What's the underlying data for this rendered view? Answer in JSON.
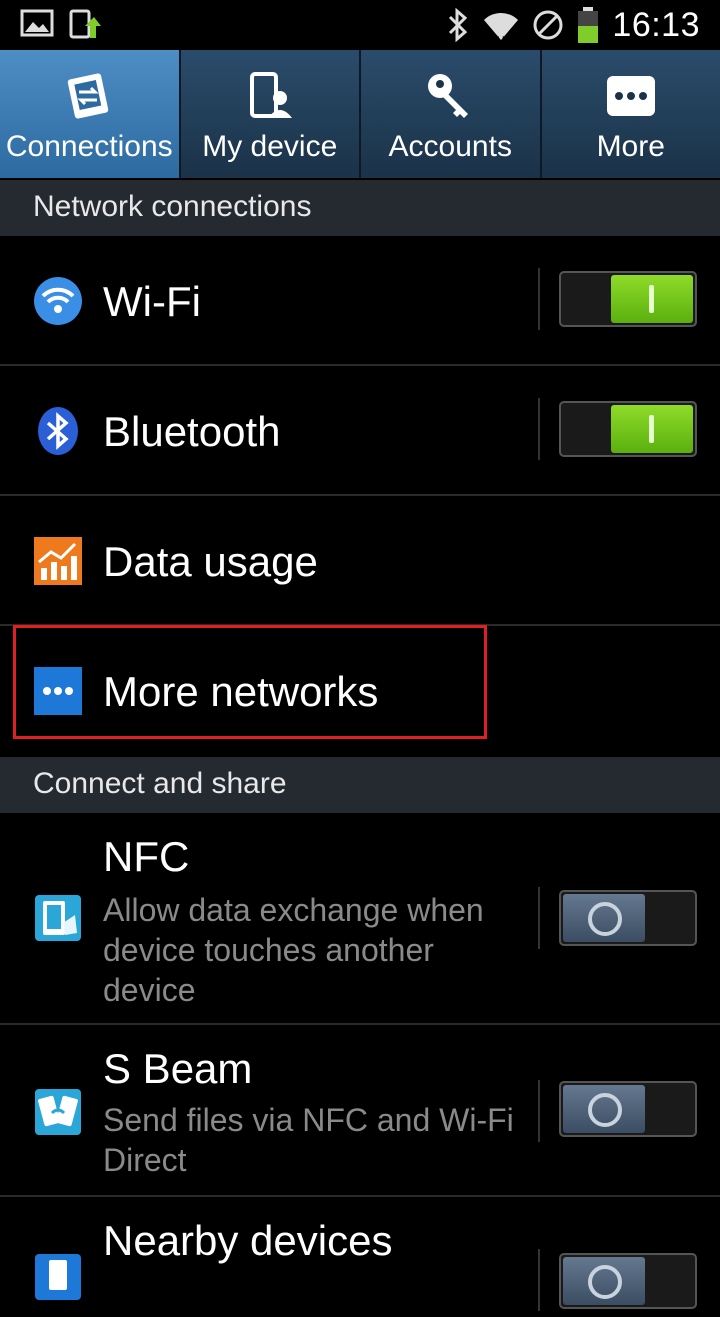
{
  "status_bar": {
    "time": "16:13",
    "icons": [
      "gallery-icon",
      "download-update-icon",
      "bluetooth-icon",
      "wifi-icon",
      "no-sim-icon",
      "battery-icon"
    ]
  },
  "tabs": [
    {
      "label": "Connections",
      "icon": "connections-icon",
      "active": true
    },
    {
      "label": "My device",
      "icon": "my-device-icon",
      "active": false
    },
    {
      "label": "Accounts",
      "icon": "accounts-key-icon",
      "active": false
    },
    {
      "label": "More",
      "icon": "more-dots-icon",
      "active": false
    }
  ],
  "sections": {
    "network": "Network connections",
    "connect": "Connect and share"
  },
  "rows": {
    "wifi": {
      "title": "Wi-Fi",
      "toggle": "on"
    },
    "bluetooth": {
      "title": "Bluetooth",
      "toggle": "on"
    },
    "data_usage": {
      "title": "Data usage"
    },
    "more_networks": {
      "title": "More networks"
    },
    "nfc": {
      "title": "NFC",
      "subtitle": "Allow data exchange when device touches another device",
      "toggle": "off"
    },
    "sbeam": {
      "title": "S Beam",
      "subtitle": "Send files via NFC and Wi-Fi Direct",
      "toggle": "off"
    },
    "nearby": {
      "title": "Nearby devices",
      "toggle": "off"
    }
  },
  "colors": {
    "accent_tab": "#3f7fb8",
    "toggle_on": "#6cc417",
    "highlight": "#e02020"
  }
}
